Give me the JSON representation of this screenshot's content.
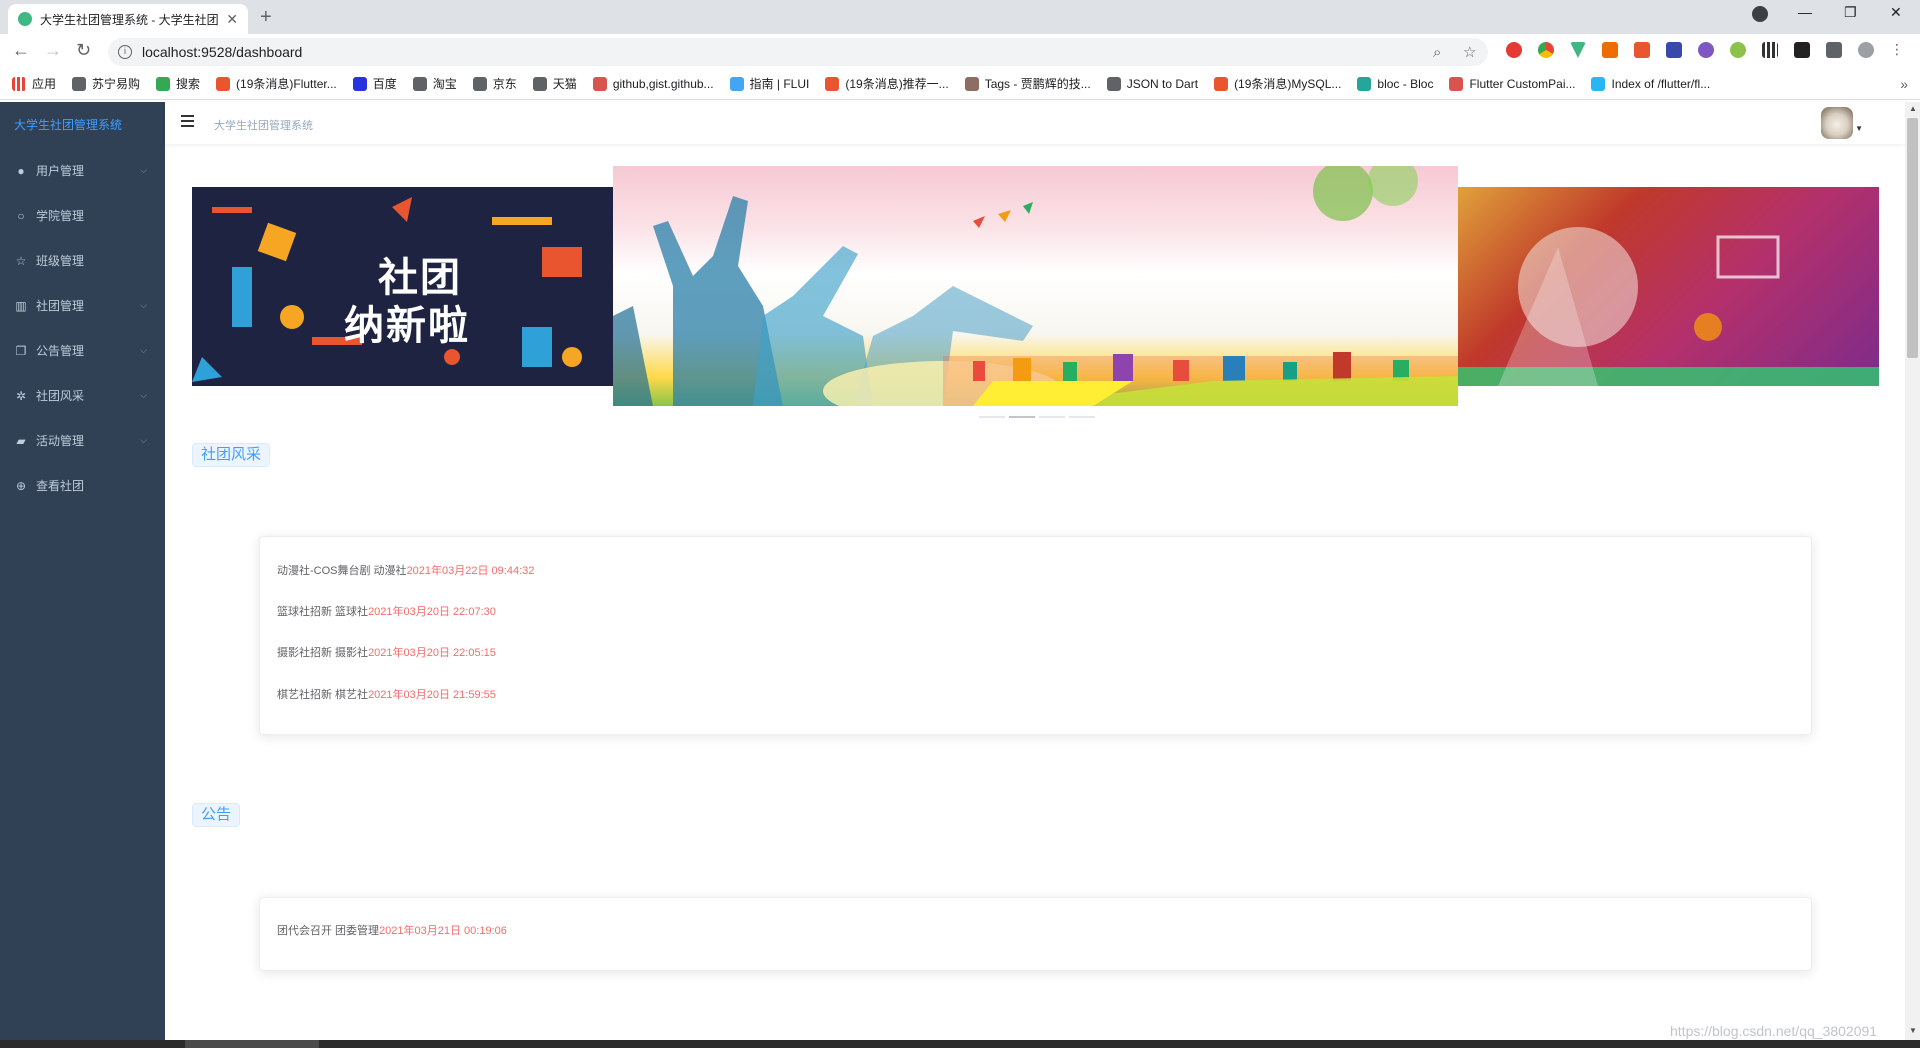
{
  "browser": {
    "tab_title": "大学生社团管理系统 - 大学生社团",
    "url": "localhost:9528/dashboard",
    "bookmarks": [
      {
        "label": "应用",
        "color": "#ea4335"
      },
      {
        "label": "苏宁易购",
        "color": "#5f6368"
      },
      {
        "label": "搜索",
        "color": "#34a853"
      },
      {
        "label": "(19条消息)Flutter...",
        "color": "#e8552f"
      },
      {
        "label": "百度",
        "color": "#2932e1"
      },
      {
        "label": "淘宝",
        "color": "#5f6368"
      },
      {
        "label": "京东",
        "color": "#5f6368"
      },
      {
        "label": "天猫",
        "color": "#5f6368"
      },
      {
        "label": "github,gist.github...",
        "color": "#d9534f"
      },
      {
        "label": "指南 | FLUI",
        "color": "#42a5f5"
      },
      {
        "label": "(19条消息)推荐一...",
        "color": "#e8552f"
      },
      {
        "label": "Tags - 贾鹏辉的技...",
        "color": "#8d6e63"
      },
      {
        "label": "JSON to Dart",
        "color": "#5f6368"
      },
      {
        "label": "(19条消息)MySQL...",
        "color": "#e8552f"
      },
      {
        "label": "bloc - Bloc",
        "color": "#26a69a"
      },
      {
        "label": "Flutter CustomPai...",
        "color": "#d9534f"
      },
      {
        "label": "Index of /flutter/fl...",
        "color": "#29b6f6"
      }
    ]
  },
  "app": {
    "brand": "大学生社团管理系统",
    "breadcrumb": "大学生社团管理系统",
    "menu": [
      {
        "label": "用户管理",
        "icon": "user-filled-icon",
        "glyph": "●",
        "has_children": true
      },
      {
        "label": "学院管理",
        "icon": "user-icon",
        "glyph": "○",
        "has_children": false
      },
      {
        "label": "班级管理",
        "icon": "star-icon",
        "glyph": "☆",
        "has_children": false
      },
      {
        "label": "社团管理",
        "icon": "building-icon",
        "glyph": "▥",
        "has_children": true
      },
      {
        "label": "公告管理",
        "icon": "copy-icon",
        "glyph": "❐",
        "has_children": true
      },
      {
        "label": "社团风采",
        "icon": "magic-icon",
        "glyph": "✲",
        "has_children": true
      },
      {
        "label": "活动管理",
        "icon": "truck-icon",
        "glyph": "▰",
        "has_children": true
      },
      {
        "label": "查看社团",
        "icon": "add-circle-icon",
        "glyph": "⊕",
        "has_children": false
      }
    ]
  },
  "carousel": {
    "left_text_line1": "社团",
    "left_text_line2": "纳新啦",
    "slides": 4,
    "active_index": 1
  },
  "sections": {
    "style_title": "社团风采",
    "style_items": [
      {
        "text": "动漫社-COS舞台剧 动漫社",
        "time": "2021年03月22日 09:44:32"
      },
      {
        "text": "篮球社招新 篮球社",
        "time": "2021年03月20日 22:07:30"
      },
      {
        "text": "摄影社招新 摄影社",
        "time": "2021年03月20日 22:05:15"
      },
      {
        "text": "棋艺社招新 棋艺社",
        "time": "2021年03月20日 21:59:55"
      }
    ],
    "notice_title": "公告",
    "notice_items": [
      {
        "text": "团代会召开 团委管理",
        "time": "2021年03月21日 00:19:06"
      }
    ]
  },
  "watermark": "https://blog.csdn.net/qq_3802091"
}
